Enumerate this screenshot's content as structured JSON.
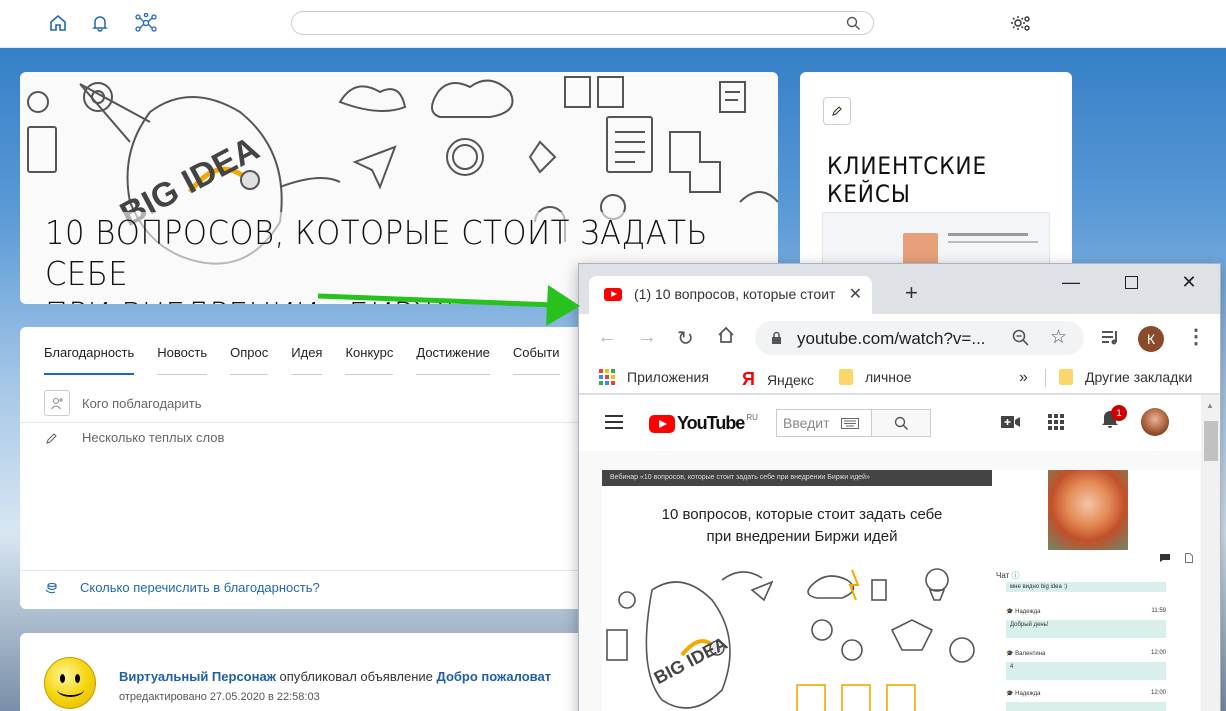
{
  "topbar": {
    "search_placeholder": ""
  },
  "banner": {
    "title_line1": "10 вопросов, которые стоит задать себе",
    "title_line2": "при внедрении «Биржи идей»",
    "doodle_text": "BIG IDEA"
  },
  "cases_card": {
    "title": "Клиентские кейсы"
  },
  "composer": {
    "tabs": [
      "Благодарность",
      "Новость",
      "Опрос",
      "Идея",
      "Конкурс",
      "Достижение",
      "Событи"
    ],
    "active_tab": "Благодарность",
    "recipient_placeholder": "Кого поблагодарить",
    "message_placeholder": "Несколько теплых слов",
    "amount_link": "Сколько перечислить в благодарность?"
  },
  "feed": {
    "author": "Виртуальный Персонаж",
    "action": " опубликовал объявление ",
    "post_title": "Добро пожаловат",
    "edited": "отредактировано 27.05.2020 в 22:58:03"
  },
  "chrome": {
    "tab_title": "(1) 10 вопросов, которые стоит",
    "url": "youtube.com/watch?v=...",
    "profile_initial": "К",
    "bookmarks": {
      "apps": "Приложения",
      "yandex": "Яндекс",
      "personal": "личное",
      "more": "»",
      "other": "Другие закладки"
    }
  },
  "youtube": {
    "logo": "YouTube",
    "region": "RU",
    "search_placeholder": "Введит",
    "notification_count": "1",
    "video": {
      "bar_text": "Вебинар «10 вопросов, которые стоит задать себе при внедрении Биржи идей»",
      "title_line1": "10 вопросов, которые стоит задать себе",
      "title_line2": "при внедрении Биржи идей"
    },
    "chat": {
      "header": "Чат",
      "messages": [
        {
          "name": "",
          "time": "",
          "text": "мне видно big idea :)"
        },
        {
          "name": "Надежда",
          "time": "11:59",
          "text": "Добрый день!"
        },
        {
          "name": "Валентина",
          "time": "12:00",
          "text": "4"
        },
        {
          "name": "Надежда",
          "time": "12:00",
          "text": ""
        }
      ]
    }
  }
}
